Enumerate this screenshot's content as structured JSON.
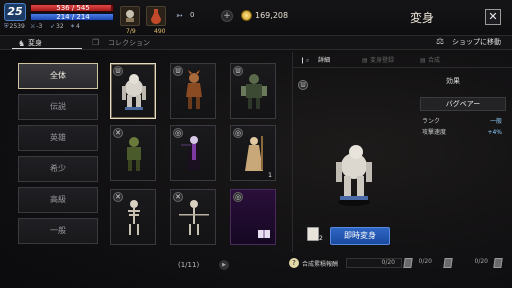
{
  "player": {
    "level": "25",
    "hp": "536 / 545",
    "hp_fraction": 0.98,
    "mp": "214 / 214",
    "mp_fraction": 1.0,
    "stats": [
      {
        "icon": "shield-icon",
        "value": "2539"
      },
      {
        "icon": "sword-icon",
        "value": "-3"
      },
      {
        "icon": "arrow-icon",
        "value": "32"
      },
      {
        "icon": "magic-icon",
        "value": "4"
      }
    ]
  },
  "topbar": {
    "item1_badge": "7/9",
    "item2_badge": "490",
    "crystal_icon": "feather-icon",
    "crystal_value": "0",
    "plus": "+",
    "gold": "169,208",
    "title": "変身",
    "close": "✕"
  },
  "tabs": {
    "transform": "変身",
    "collection": "コレクション",
    "shop": "ショップに移動"
  },
  "categories": [
    "全体",
    "伝説",
    "英雄",
    "希少",
    "高級",
    "一般"
  ],
  "grid": {
    "cards": [
      {
        "type": "beast",
        "icon": "claw-icon",
        "count": ""
      },
      {
        "type": "beast",
        "icon": "claw-icon",
        "count": ""
      },
      {
        "type": "beast",
        "icon": "claw-icon",
        "count": ""
      },
      {
        "type": "warrior",
        "icon": "sword-cross-icon",
        "count": ""
      },
      {
        "type": "caster",
        "icon": "magic-circle-icon",
        "count": ""
      },
      {
        "type": "caster",
        "icon": "magic-circle-icon",
        "count": "1"
      },
      {
        "type": "warrior",
        "icon": "sword-cross-icon",
        "count": ""
      },
      {
        "type": "warrior",
        "icon": "sword-cross-icon",
        "count": ""
      },
      {
        "type": "scroll",
        "icon": "magic-circle-icon",
        "count": ""
      }
    ],
    "page": "(1/11)"
  },
  "preview": {
    "tab_detail": "詳細",
    "tab_register": "変身登録",
    "tab_combine": "合成",
    "item_count": "2",
    "instant_button": "即時変身"
  },
  "effects": {
    "header": "効果",
    "name": "バグベアー",
    "rows": [
      {
        "label": "ランク",
        "value": "一般"
      },
      {
        "label": "攻撃速度",
        "value": "+4%"
      }
    ]
  },
  "bottom": {
    "label": "合成累積報酬",
    "progress": [
      "0/20",
      "0/20",
      "0/20"
    ]
  },
  "colors": {
    "accent_blue": "#2e66c4",
    "hp_red": "#c02626",
    "mp_blue": "#2f5fcf",
    "selected_border": "#e6dcc0"
  }
}
